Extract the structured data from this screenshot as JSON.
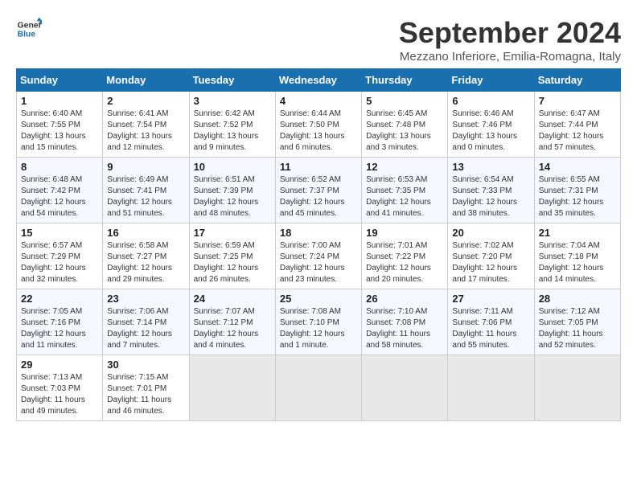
{
  "logo": {
    "line1": "General",
    "line2": "Blue"
  },
  "title": "September 2024",
  "subtitle": "Mezzano Inferiore, Emilia-Romagna, Italy",
  "headers": [
    "Sunday",
    "Monday",
    "Tuesday",
    "Wednesday",
    "Thursday",
    "Friday",
    "Saturday"
  ],
  "weeks": [
    [
      {
        "day": "1",
        "info": "Sunrise: 6:40 AM\nSunset: 7:55 PM\nDaylight: 13 hours\nand 15 minutes."
      },
      {
        "day": "2",
        "info": "Sunrise: 6:41 AM\nSunset: 7:54 PM\nDaylight: 13 hours\nand 12 minutes."
      },
      {
        "day": "3",
        "info": "Sunrise: 6:42 AM\nSunset: 7:52 PM\nDaylight: 13 hours\nand 9 minutes."
      },
      {
        "day": "4",
        "info": "Sunrise: 6:44 AM\nSunset: 7:50 PM\nDaylight: 13 hours\nand 6 minutes."
      },
      {
        "day": "5",
        "info": "Sunrise: 6:45 AM\nSunset: 7:48 PM\nDaylight: 13 hours\nand 3 minutes."
      },
      {
        "day": "6",
        "info": "Sunrise: 6:46 AM\nSunset: 7:46 PM\nDaylight: 13 hours\nand 0 minutes."
      },
      {
        "day": "7",
        "info": "Sunrise: 6:47 AM\nSunset: 7:44 PM\nDaylight: 12 hours\nand 57 minutes."
      }
    ],
    [
      {
        "day": "8",
        "info": "Sunrise: 6:48 AM\nSunset: 7:42 PM\nDaylight: 12 hours\nand 54 minutes."
      },
      {
        "day": "9",
        "info": "Sunrise: 6:49 AM\nSunset: 7:41 PM\nDaylight: 12 hours\nand 51 minutes."
      },
      {
        "day": "10",
        "info": "Sunrise: 6:51 AM\nSunset: 7:39 PM\nDaylight: 12 hours\nand 48 minutes."
      },
      {
        "day": "11",
        "info": "Sunrise: 6:52 AM\nSunset: 7:37 PM\nDaylight: 12 hours\nand 45 minutes."
      },
      {
        "day": "12",
        "info": "Sunrise: 6:53 AM\nSunset: 7:35 PM\nDaylight: 12 hours\nand 41 minutes."
      },
      {
        "day": "13",
        "info": "Sunrise: 6:54 AM\nSunset: 7:33 PM\nDaylight: 12 hours\nand 38 minutes."
      },
      {
        "day": "14",
        "info": "Sunrise: 6:55 AM\nSunset: 7:31 PM\nDaylight: 12 hours\nand 35 minutes."
      }
    ],
    [
      {
        "day": "15",
        "info": "Sunrise: 6:57 AM\nSunset: 7:29 PM\nDaylight: 12 hours\nand 32 minutes."
      },
      {
        "day": "16",
        "info": "Sunrise: 6:58 AM\nSunset: 7:27 PM\nDaylight: 12 hours\nand 29 minutes."
      },
      {
        "day": "17",
        "info": "Sunrise: 6:59 AM\nSunset: 7:25 PM\nDaylight: 12 hours\nand 26 minutes."
      },
      {
        "day": "18",
        "info": "Sunrise: 7:00 AM\nSunset: 7:24 PM\nDaylight: 12 hours\nand 23 minutes."
      },
      {
        "day": "19",
        "info": "Sunrise: 7:01 AM\nSunset: 7:22 PM\nDaylight: 12 hours\nand 20 minutes."
      },
      {
        "day": "20",
        "info": "Sunrise: 7:02 AM\nSunset: 7:20 PM\nDaylight: 12 hours\nand 17 minutes."
      },
      {
        "day": "21",
        "info": "Sunrise: 7:04 AM\nSunset: 7:18 PM\nDaylight: 12 hours\nand 14 minutes."
      }
    ],
    [
      {
        "day": "22",
        "info": "Sunrise: 7:05 AM\nSunset: 7:16 PM\nDaylight: 12 hours\nand 11 minutes."
      },
      {
        "day": "23",
        "info": "Sunrise: 7:06 AM\nSunset: 7:14 PM\nDaylight: 12 hours\nand 7 minutes."
      },
      {
        "day": "24",
        "info": "Sunrise: 7:07 AM\nSunset: 7:12 PM\nDaylight: 12 hours\nand 4 minutes."
      },
      {
        "day": "25",
        "info": "Sunrise: 7:08 AM\nSunset: 7:10 PM\nDaylight: 12 hours\nand 1 minute."
      },
      {
        "day": "26",
        "info": "Sunrise: 7:10 AM\nSunset: 7:08 PM\nDaylight: 11 hours\nand 58 minutes."
      },
      {
        "day": "27",
        "info": "Sunrise: 7:11 AM\nSunset: 7:06 PM\nDaylight: 11 hours\nand 55 minutes."
      },
      {
        "day": "28",
        "info": "Sunrise: 7:12 AM\nSunset: 7:05 PM\nDaylight: 11 hours\nand 52 minutes."
      }
    ],
    [
      {
        "day": "29",
        "info": "Sunrise: 7:13 AM\nSunset: 7:03 PM\nDaylight: 11 hours\nand 49 minutes."
      },
      {
        "day": "30",
        "info": "Sunrise: 7:15 AM\nSunset: 7:01 PM\nDaylight: 11 hours\nand 46 minutes."
      },
      {
        "day": "",
        "info": ""
      },
      {
        "day": "",
        "info": ""
      },
      {
        "day": "",
        "info": ""
      },
      {
        "day": "",
        "info": ""
      },
      {
        "day": "",
        "info": ""
      }
    ]
  ]
}
